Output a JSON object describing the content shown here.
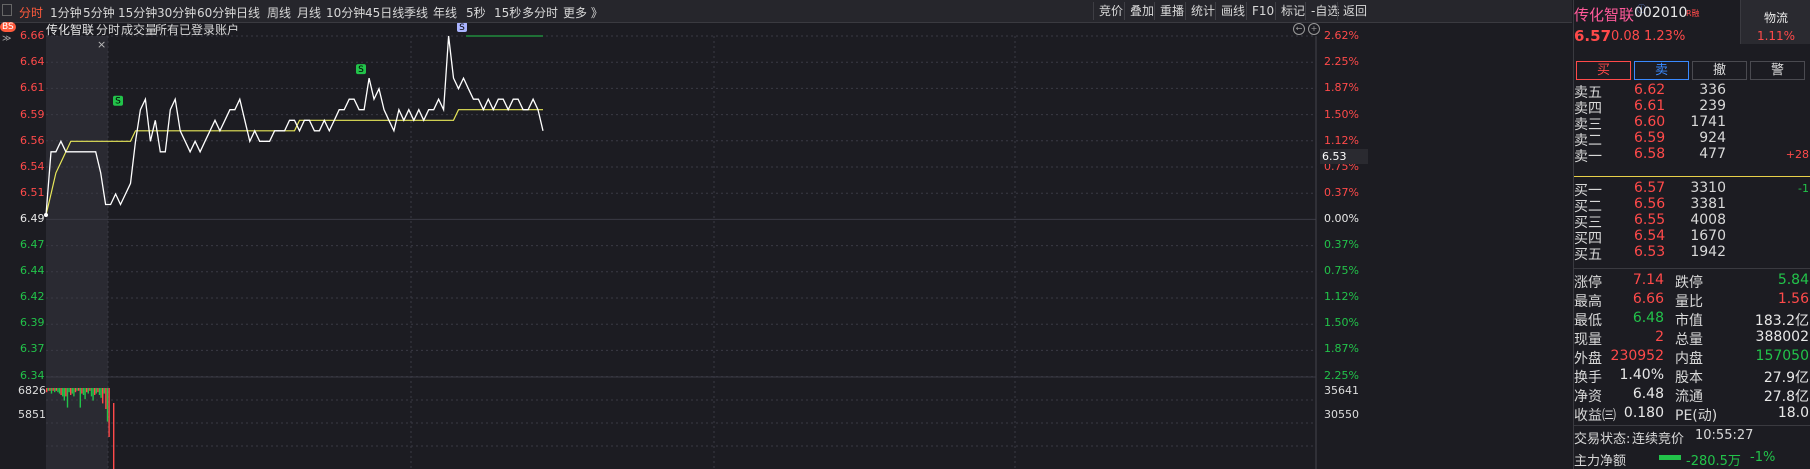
{
  "toolbar": {
    "tabs": [
      "分时",
      "1分钟",
      "5分钟",
      "15分钟",
      "30分钟",
      "60分钟",
      "日线",
      "周线",
      "月线",
      "10分钟",
      "45日线",
      "季线",
      "年线",
      "5秒",
      "15秒",
      "多分时",
      "更多 》"
    ],
    "active_tab": "分时",
    "right_buttons": [
      "竞价",
      "叠加",
      "重播",
      "统计",
      "画线",
      "F10",
      "标记",
      "-自选",
      "返回"
    ]
  },
  "chart": {
    "title": "传化智联",
    "subtitle_items": [
      "分时",
      "成交量",
      "所有已登录账户"
    ],
    "bs_badge": "BS",
    "close_symbol": "×",
    "left_price_labels": [
      "6.66",
      "6.64",
      "6.61",
      "6.59",
      "6.56",
      "6.54",
      "6.51",
      "6.49",
      "6.47",
      "6.44",
      "6.42",
      "6.39",
      "6.37",
      "6.34"
    ],
    "right_pct_labels": [
      "2.62%",
      "2.25%",
      "1.87%",
      "1.50%",
      "1.12%",
      "0.75%",
      "0.37%",
      "0.00%",
      "0.37%",
      "0.75%",
      "1.12%",
      "1.50%",
      "1.87%",
      "2.25%"
    ],
    "current_price_tag": "6.53",
    "volume_left_labels": [
      "6826",
      "5851"
    ],
    "volume_right_labels": [
      "35641",
      "30550"
    ],
    "signal_letters": [
      "S",
      "S",
      "S"
    ],
    "colors": {
      "price_line": "#ffffff",
      "avg_line": "#e8e85a",
      "up": "#ff4a4a",
      "down": "#22c34a",
      "grid": "#3a3a44",
      "bg": "#1c1c22"
    }
  },
  "chart_data": {
    "type": "line",
    "series": [
      {
        "values": [
          6.49,
          6.55,
          6.55,
          6.56,
          6.55,
          6.55,
          6.55,
          6.55,
          6.55,
          6.55,
          6.55,
          6.53,
          6.5,
          6.5,
          6.51,
          6.5,
          6.51,
          6.52,
          6.56,
          6.59,
          6.6,
          6.56,
          6.58,
          6.55,
          6.55,
          6.59,
          6.6,
          6.57,
          6.56,
          6.55,
          6.56,
          6.55,
          6.56,
          6.57,
          6.58,
          6.57,
          6.58,
          6.59,
          6.59,
          6.6,
          6.58,
          6.56,
          6.57,
          6.56,
          6.56,
          6.56,
          6.57,
          6.57,
          6.57,
          6.58,
          6.58,
          6.57,
          6.58,
          6.58,
          6.57,
          6.57,
          6.58,
          6.57,
          6.58,
          6.59,
          6.59,
          6.6,
          6.6,
          6.59,
          6.59,
          6.62,
          6.6,
          6.61,
          6.59,
          6.58,
          6.57,
          6.59,
          6.58,
          6.59,
          6.58,
          6.59,
          6.58,
          6.59,
          6.59,
          6.6,
          6.59,
          6.66,
          6.62,
          6.61,
          6.62,
          6.61,
          6.6,
          6.6,
          6.59,
          6.6,
          6.59,
          6.6,
          6.6,
          6.59,
          6.6,
          6.6,
          6.59,
          6.59,
          6.6,
          6.59,
          6.57
        ]
      },
      {
        "values": [
          6.49,
          6.51,
          6.53,
          6.54,
          6.55,
          6.56,
          6.56,
          6.56,
          6.56,
          6.56,
          6.56,
          6.56,
          6.56,
          6.56,
          6.56,
          6.56,
          6.56,
          6.56,
          6.57,
          6.57,
          6.57,
          6.57,
          6.57,
          6.57,
          6.57,
          6.57,
          6.57,
          6.57,
          6.57,
          6.57,
          6.57,
          6.57,
          6.57,
          6.57,
          6.57,
          6.57,
          6.57,
          6.57,
          6.57,
          6.57,
          6.57,
          6.57,
          6.57,
          6.57,
          6.57,
          6.57,
          6.57,
          6.57,
          6.57,
          6.57,
          6.57,
          6.58,
          6.58,
          6.58,
          6.58,
          6.58,
          6.58,
          6.58,
          6.58,
          6.58,
          6.58,
          6.58,
          6.58,
          6.58,
          6.58,
          6.58,
          6.58,
          6.58,
          6.58,
          6.58,
          6.58,
          6.58,
          6.58,
          6.58,
          6.58,
          6.58,
          6.58,
          6.58,
          6.58,
          6.58,
          6.58,
          6.58,
          6.58,
          6.59,
          6.59,
          6.59,
          6.59,
          6.59,
          6.59,
          6.59,
          6.59,
          6.59,
          6.59,
          6.59,
          6.59,
          6.59,
          6.59,
          6.59,
          6.59,
          6.59,
          6.59
        ]
      }
    ],
    "ylim": [
      6.34,
      6.66
    ],
    "volumes": [
      3,
      2,
      2,
      4,
      2,
      3,
      2,
      3,
      4,
      5,
      6,
      9,
      6,
      14,
      3,
      5,
      4,
      6,
      3,
      2,
      2,
      14,
      4,
      5,
      8,
      3,
      4,
      2,
      6,
      9,
      5,
      4,
      3,
      5,
      7,
      11,
      4,
      15,
      24,
      35
    ],
    "volume_colors": [
      "up",
      "down",
      "up",
      "down",
      "up",
      "down",
      "up",
      "down",
      "down",
      "up",
      "down",
      "down",
      "up",
      "down",
      "down",
      "up",
      "down",
      "down",
      "up",
      "down",
      "up",
      "down",
      "up",
      "down",
      "down",
      "up",
      "down",
      "up",
      "down",
      "down",
      "up",
      "down",
      "up",
      "down",
      "down",
      "up",
      "down",
      "up",
      "down",
      "up"
    ]
  },
  "quote": {
    "name": "传化智联",
    "code": "002010",
    "tags": "R融",
    "sector": "物流",
    "sector_change": "1.11%",
    "price": "6.57",
    "change": "0.08",
    "change_pct": "1.23%",
    "actions": [
      "买",
      "卖",
      "撤",
      "警"
    ],
    "asks": [
      {
        "label": "卖五",
        "price": "6.62",
        "vol": "336",
        "delta": ""
      },
      {
        "label": "卖四",
        "price": "6.61",
        "vol": "239",
        "delta": ""
      },
      {
        "label": "卖三",
        "price": "6.60",
        "vol": "1741",
        "delta": ""
      },
      {
        "label": "卖二",
        "price": "6.59",
        "vol": "924",
        "delta": ""
      },
      {
        "label": "卖一",
        "price": "6.58",
        "vol": "477",
        "delta": "+28"
      }
    ],
    "bids": [
      {
        "label": "买一",
        "price": "6.57",
        "vol": "3310",
        "delta": "-1"
      },
      {
        "label": "买二",
        "price": "6.56",
        "vol": "3381",
        "delta": ""
      },
      {
        "label": "买三",
        "price": "6.55",
        "vol": "4008",
        "delta": ""
      },
      {
        "label": "买四",
        "price": "6.54",
        "vol": "1670",
        "delta": ""
      },
      {
        "label": "买五",
        "price": "6.53",
        "vol": "1942",
        "delta": ""
      }
    ],
    "stats": [
      {
        "l1": "涨停",
        "v1": "7.14",
        "c1": "red",
        "l2": "跌停",
        "v2": "5.84",
        "c2": "green"
      },
      {
        "l1": "最高",
        "v1": "6.66",
        "c1": "red",
        "l2": "量比",
        "v2": "1.56",
        "c2": "red"
      },
      {
        "l1": "最低",
        "v1": "6.48",
        "c1": "green",
        "l2": "市值",
        "v2": "183.2亿",
        "c2": "white"
      },
      {
        "l1": "现量",
        "v1": "2",
        "c1": "red",
        "l2": "总量",
        "v2": "388002",
        "c2": "white"
      },
      {
        "l1": "外盘",
        "v1": "230952",
        "c1": "red",
        "l2": "内盘",
        "v2": "157050",
        "c2": "green"
      },
      {
        "l1": "换手",
        "v1": "1.40%",
        "c1": "white",
        "l2": "股本",
        "v2": "27.9亿",
        "c2": "white"
      },
      {
        "l1": "净资",
        "v1": "6.48",
        "c1": "white",
        "l2": "流通",
        "v2": "27.8亿",
        "c2": "white"
      },
      {
        "l1": "收益㈢",
        "v1": "0.180",
        "c1": "white",
        "l2": "PE(动)",
        "v2": "18.0",
        "c2": "white"
      }
    ],
    "trade_status_label": "交易状态:",
    "trade_status": "连续竞价",
    "time": "10:55:27",
    "main_net_label": "主力净额",
    "main_net_value": "-280.5万",
    "main_net_pct": "-1%"
  }
}
